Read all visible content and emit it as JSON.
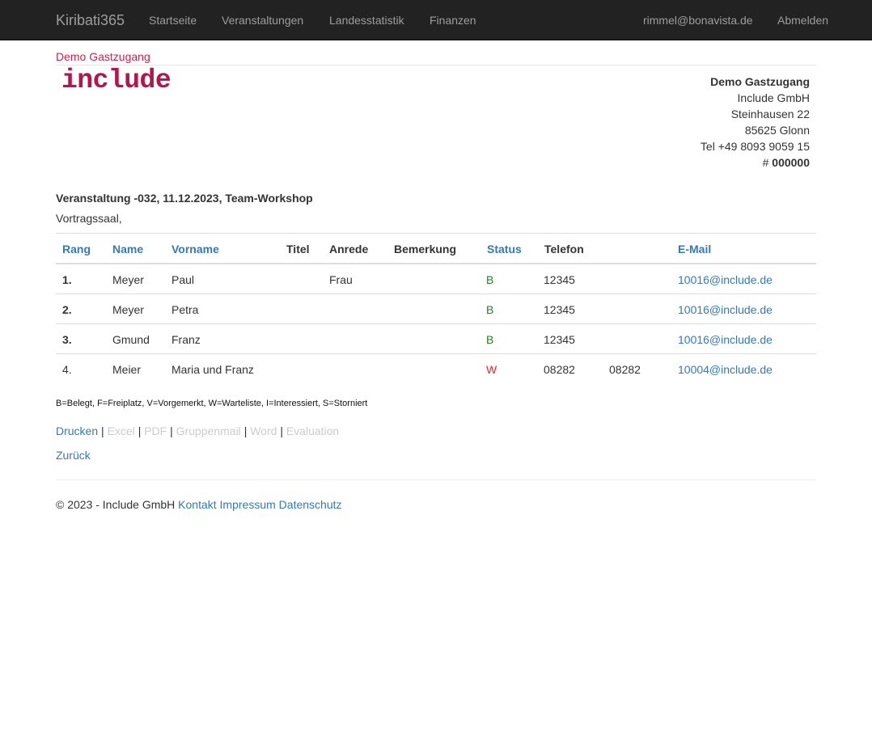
{
  "navbar": {
    "brand": "Kiribati365",
    "items": [
      "Startseite",
      "Veranstaltungen",
      "Landesstatistik",
      "Finanzen"
    ],
    "user": "rimmel@bonavista.de",
    "logout": "Abmelden"
  },
  "breadcrumb": "Demo Gastzugang",
  "logo_text": "include",
  "address": {
    "name": "Demo Gastzugang",
    "company": "Include GmbH",
    "street": "Steinhausen 22",
    "city": "85625 Glonn",
    "phone": "Tel +49 8093 9059 15",
    "number_prefix": "# ",
    "number": "000000"
  },
  "event": {
    "title": "Veranstaltung -032, 11.12.2023, Team-Workshop",
    "location": "Vortragssaal,"
  },
  "table": {
    "headers": {
      "rang": "Rang",
      "name": "Name",
      "vorname": "Vorname",
      "titel": "Titel",
      "anrede": "Anrede",
      "bemerkung": "Bemerkung",
      "status": "Status",
      "telefon": "Telefon",
      "email": "E-Mail"
    },
    "rows": [
      {
        "rang": "1.",
        "name": "Meyer",
        "vorname": "Paul",
        "titel": "",
        "anrede": "Frau",
        "bemerkung": "",
        "status": "B",
        "telefon": "12345",
        "telefon2": "",
        "email": "10016@include.de"
      },
      {
        "rang": "2.",
        "name": "Meyer",
        "vorname": "Petra",
        "titel": "",
        "anrede": "",
        "bemerkung": "",
        "status": "B",
        "telefon": "12345",
        "telefon2": "",
        "email": "10016@include.de"
      },
      {
        "rang": "3.",
        "name": "Gmund",
        "vorname": "Franz",
        "titel": "",
        "anrede": "",
        "bemerkung": "",
        "status": "B",
        "telefon": "12345",
        "telefon2": "",
        "email": "10016@include.de"
      },
      {
        "rang": "4.",
        "name": "Meier",
        "vorname": "Maria und Franz",
        "titel": "",
        "anrede": "",
        "bemerkung": "",
        "status": "W",
        "telefon": "08282",
        "telefon2": "08282",
        "email": "10004@include.de"
      }
    ]
  },
  "legend": "B=Belegt, F=Freiplatz, V=Vorgemerkt, W=Warteliste, I=Interessiert, S=Storniert",
  "actions": {
    "print": "Drucken",
    "excel": "Excel",
    "pdf": "PDF",
    "groupmail": "Gruppenmail",
    "word": "Word",
    "evaluation": "Evaluation",
    "separator": "|"
  },
  "back": "Zurück",
  "footer": {
    "copyright": "© 2023 - Include GmbH",
    "links": [
      "Kontakt",
      "Impressum",
      "Datenschutz"
    ]
  },
  "colors": {
    "navbar_bg": "#222222",
    "link": "#337ab7",
    "brand_red": "#b4154a",
    "status_booked": "#2b7b2b",
    "status_waitlist": "#e8262b"
  }
}
